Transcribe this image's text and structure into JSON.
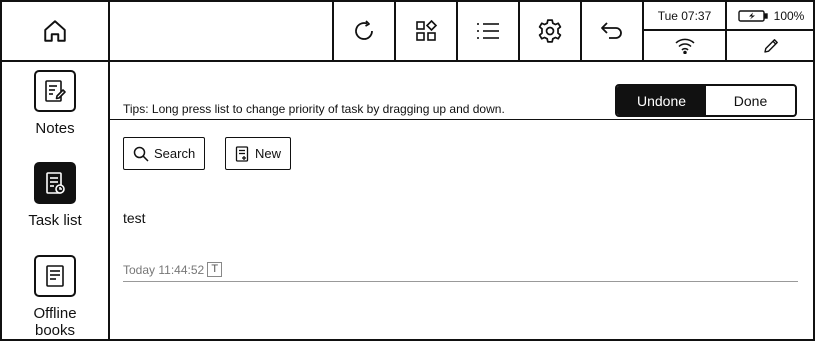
{
  "toolbar": {
    "home_icon": "home-icon",
    "tools": [
      "refresh-icon",
      "apps-icon",
      "list-icon",
      "settings-icon",
      "back-icon"
    ],
    "time": "Tue 07:37",
    "battery": "100%",
    "wifi_icon": "wifi-icon",
    "pen_icon": "pen-icon"
  },
  "sidebar": {
    "items": [
      {
        "label": "Notes",
        "icon": "notes-icon"
      },
      {
        "label": "Task list",
        "icon": "task-list-icon"
      },
      {
        "label": "Offline books",
        "icon": "book-icon"
      }
    ]
  },
  "main": {
    "tips": "Tips: Long press list to change priority of task by dragging up and down.",
    "tabs": [
      "Undone",
      "Done"
    ],
    "search_label": "Search",
    "new_label": "New",
    "task": {
      "title": "test",
      "time": "Today 11:44:52",
      "badge": "T"
    }
  }
}
